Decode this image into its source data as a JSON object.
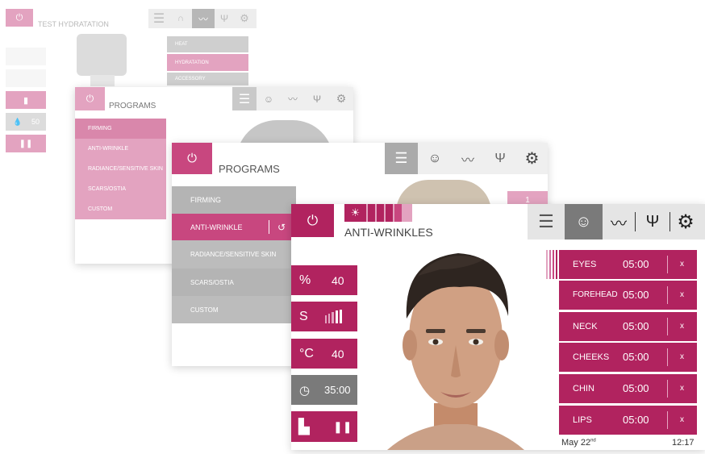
{
  "layer1": {
    "title": "TEST HYDRATATION",
    "menu": [
      "HEAT",
      "HYDRATATION",
      "ACCESSORY"
    ],
    "value": "50"
  },
  "layer2": {
    "title": "PROGRAMS",
    "menu": [
      "FIRMING",
      "ANTI-WRINKLE",
      "RADIANCE/SENSITIVE SKIN",
      "SCARS/OSTIA",
      "CUSTOM"
    ]
  },
  "layer3": {
    "title": "PROGRAMS",
    "menu": [
      "FIRMING",
      "ANTI-WRINKLE",
      "RADIANCE/SENSITIVE SKIN",
      "SCARS/OSTIA",
      "CUSTOM"
    ],
    "badge": "1"
  },
  "main": {
    "title": "ANTI-WRINKLES",
    "params": [
      {
        "icon": "%",
        "value": "40"
      },
      {
        "icon": "S",
        "value": ""
      },
      {
        "icon": "°C",
        "value": "40"
      },
      {
        "icon": "clock-icon",
        "value": "35:00"
      }
    ],
    "zones": [
      {
        "name": "EYES",
        "time": "05:00",
        "close": "x"
      },
      {
        "name": "FOREHEAD",
        "time": "05:00",
        "close": "x"
      },
      {
        "name": "NECK",
        "time": "05:00",
        "close": "x"
      },
      {
        "name": "CHEEKS",
        "time": "05:00",
        "close": "x"
      },
      {
        "name": "CHIN",
        "time": "05:00",
        "close": "x"
      },
      {
        "name": "LIPS",
        "time": "05:00",
        "close": "x"
      }
    ],
    "date": "May 22",
    "date_suffix": "nd",
    "time": "12:17"
  },
  "colors": {
    "accent": "#b1235f",
    "accent_light": "#e3a3c0",
    "toolbar": "#e5e5e5"
  }
}
